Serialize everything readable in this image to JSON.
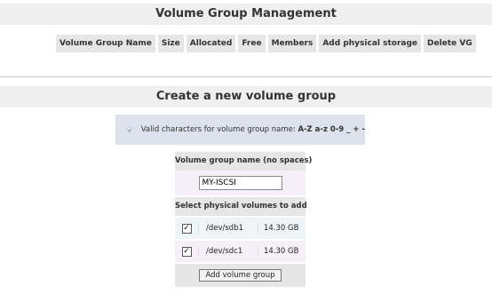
{
  "vg_section": {
    "title": "Volume Group Management",
    "columns": [
      "Volume Group Name",
      "Size",
      "Allocated",
      "Free",
      "Members",
      "Add physical storage",
      "Delete VG"
    ]
  },
  "create_section": {
    "title": "Create a new volume group",
    "info_text": "Valid characters for volume group name:",
    "info_chars": "A-Z a-z 0-9 _ + -",
    "name_label": "Volume group name (no spaces)",
    "name_value": "MY-ISCSI",
    "pv_label": "Select physical volumes to add",
    "physical_volumes": [
      {
        "device": "/dev/sdb1",
        "size": "14.30 GB",
        "checked": true
      },
      {
        "device": "/dev/sdc1",
        "size": "14.30 GB",
        "checked": true
      }
    ],
    "submit_label": "Add volume group"
  },
  "icons": {
    "info": "lightbulb-icon"
  }
}
